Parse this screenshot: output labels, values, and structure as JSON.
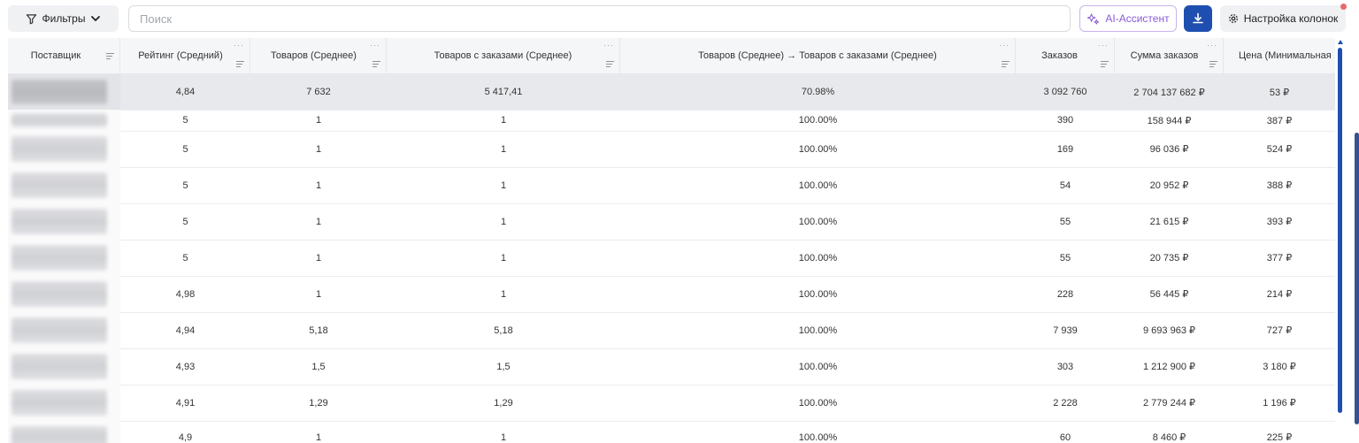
{
  "toolbar": {
    "filters_label": "Фильтры",
    "search_placeholder": "Поиск",
    "ai_label": "AI-Ассистент",
    "columns_label": "Настройка колонок"
  },
  "table": {
    "headers": [
      "Поставщик",
      "Рейтинг (Средний)",
      "Товаров (Среднее)",
      "Товаров с заказами (Среднее)",
      "Товаров (Среднее) → Товаров с заказами (Среднее)",
      "Заказов",
      "Сумма заказов",
      "Цена (Минимальная"
    ],
    "total": [
      "",
      "4,84",
      "7 632",
      "5 417,41",
      "70.98%",
      "3 092 760",
      "2 704 137 682 ₽",
      "53 ₽"
    ],
    "rows": [
      [
        "",
        "5",
        "1",
        "1",
        "100.00%",
        "390",
        "158 944 ₽",
        "387 ₽"
      ],
      [
        "",
        "5",
        "1",
        "1",
        "100.00%",
        "169",
        "96 036 ₽",
        "524 ₽"
      ],
      [
        "",
        "5",
        "1",
        "1",
        "100.00%",
        "54",
        "20 952 ₽",
        "388 ₽"
      ],
      [
        "",
        "5",
        "1",
        "1",
        "100.00%",
        "55",
        "21 615 ₽",
        "393 ₽"
      ],
      [
        "",
        "5",
        "1",
        "1",
        "100.00%",
        "55",
        "20 735 ₽",
        "377 ₽"
      ],
      [
        "",
        "4,98",
        "1",
        "1",
        "100.00%",
        "228",
        "56 445 ₽",
        "214 ₽"
      ],
      [
        "",
        "4,94",
        "5,18",
        "5,18",
        "100.00%",
        "7 939",
        "9 693 963 ₽",
        "727 ₽"
      ],
      [
        "",
        "4,93",
        "1,5",
        "1,5",
        "100.00%",
        "303",
        "1 212 900 ₽",
        "3 180 ₽"
      ],
      [
        "",
        "4,91",
        "1,29",
        "1,29",
        "100.00%",
        "2 228",
        "2 779 244 ₽",
        "1 196 ₽"
      ],
      [
        "",
        "4,9",
        "1",
        "1",
        "100.00%",
        "60",
        "8 460 ₽",
        "225 ₽"
      ]
    ]
  },
  "colors": {
    "accent": "#1e4fb0",
    "ai_purple": "#8a5cd6",
    "notification": "#e66a6a"
  }
}
